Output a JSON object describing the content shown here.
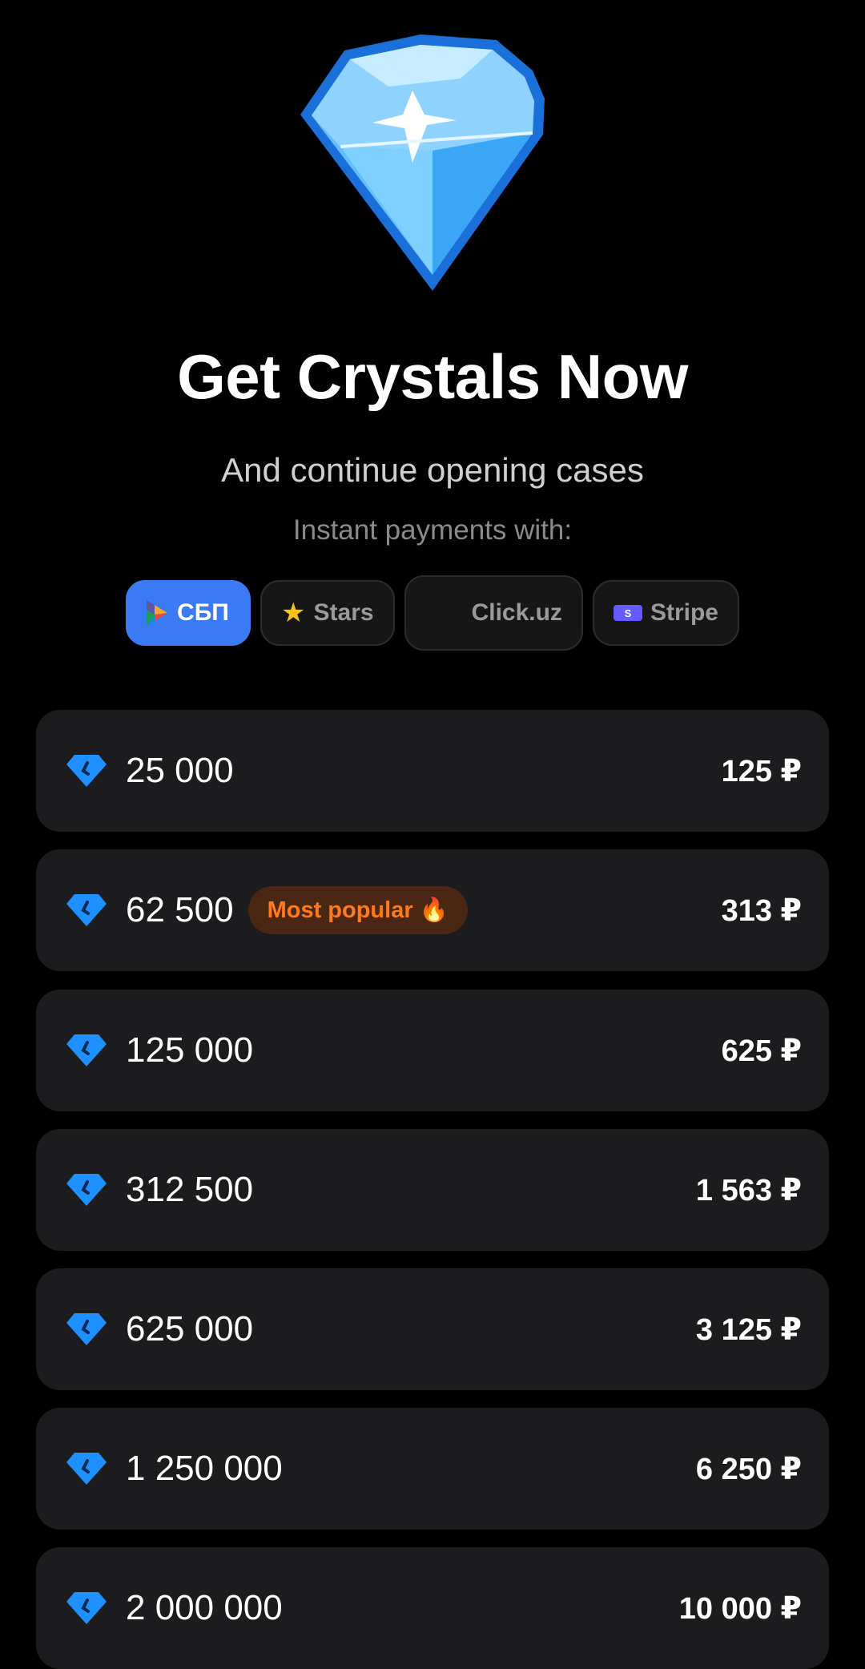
{
  "header": {
    "title": "Get Crystals Now",
    "subtitle": "And continue opening cases",
    "payments_label": "Instant payments with:"
  },
  "payment_methods": [
    {
      "label": "СБП",
      "icon": "sbp-logo-icon",
      "selected": true
    },
    {
      "label": "Stars",
      "icon": "star-icon",
      "selected": false
    },
    {
      "label": "Click.uz",
      "icon": "uzbekistan-flag-icon",
      "selected": false
    },
    {
      "label": "Stripe",
      "icon": "stripe-logo-icon",
      "selected": false
    }
  ],
  "packages": [
    {
      "amount": "25 000",
      "price": "125 ₽"
    },
    {
      "amount": "62 500",
      "badge": "Most popular 🔥",
      "price": "313 ₽"
    },
    {
      "amount": "125 000",
      "price": "625 ₽"
    },
    {
      "amount": "312 500",
      "price": "1 563 ₽"
    },
    {
      "amount": "625 000",
      "price": "3 125 ₽"
    },
    {
      "amount": "1 250 000",
      "price": "6 250 ₽"
    },
    {
      "amount": "2 000 000",
      "price": "10 000 ₽"
    }
  ],
  "colors": {
    "accent": "#3a7bf5",
    "badge_text": "#ff7a1f",
    "crystal": "#1e90ff"
  }
}
